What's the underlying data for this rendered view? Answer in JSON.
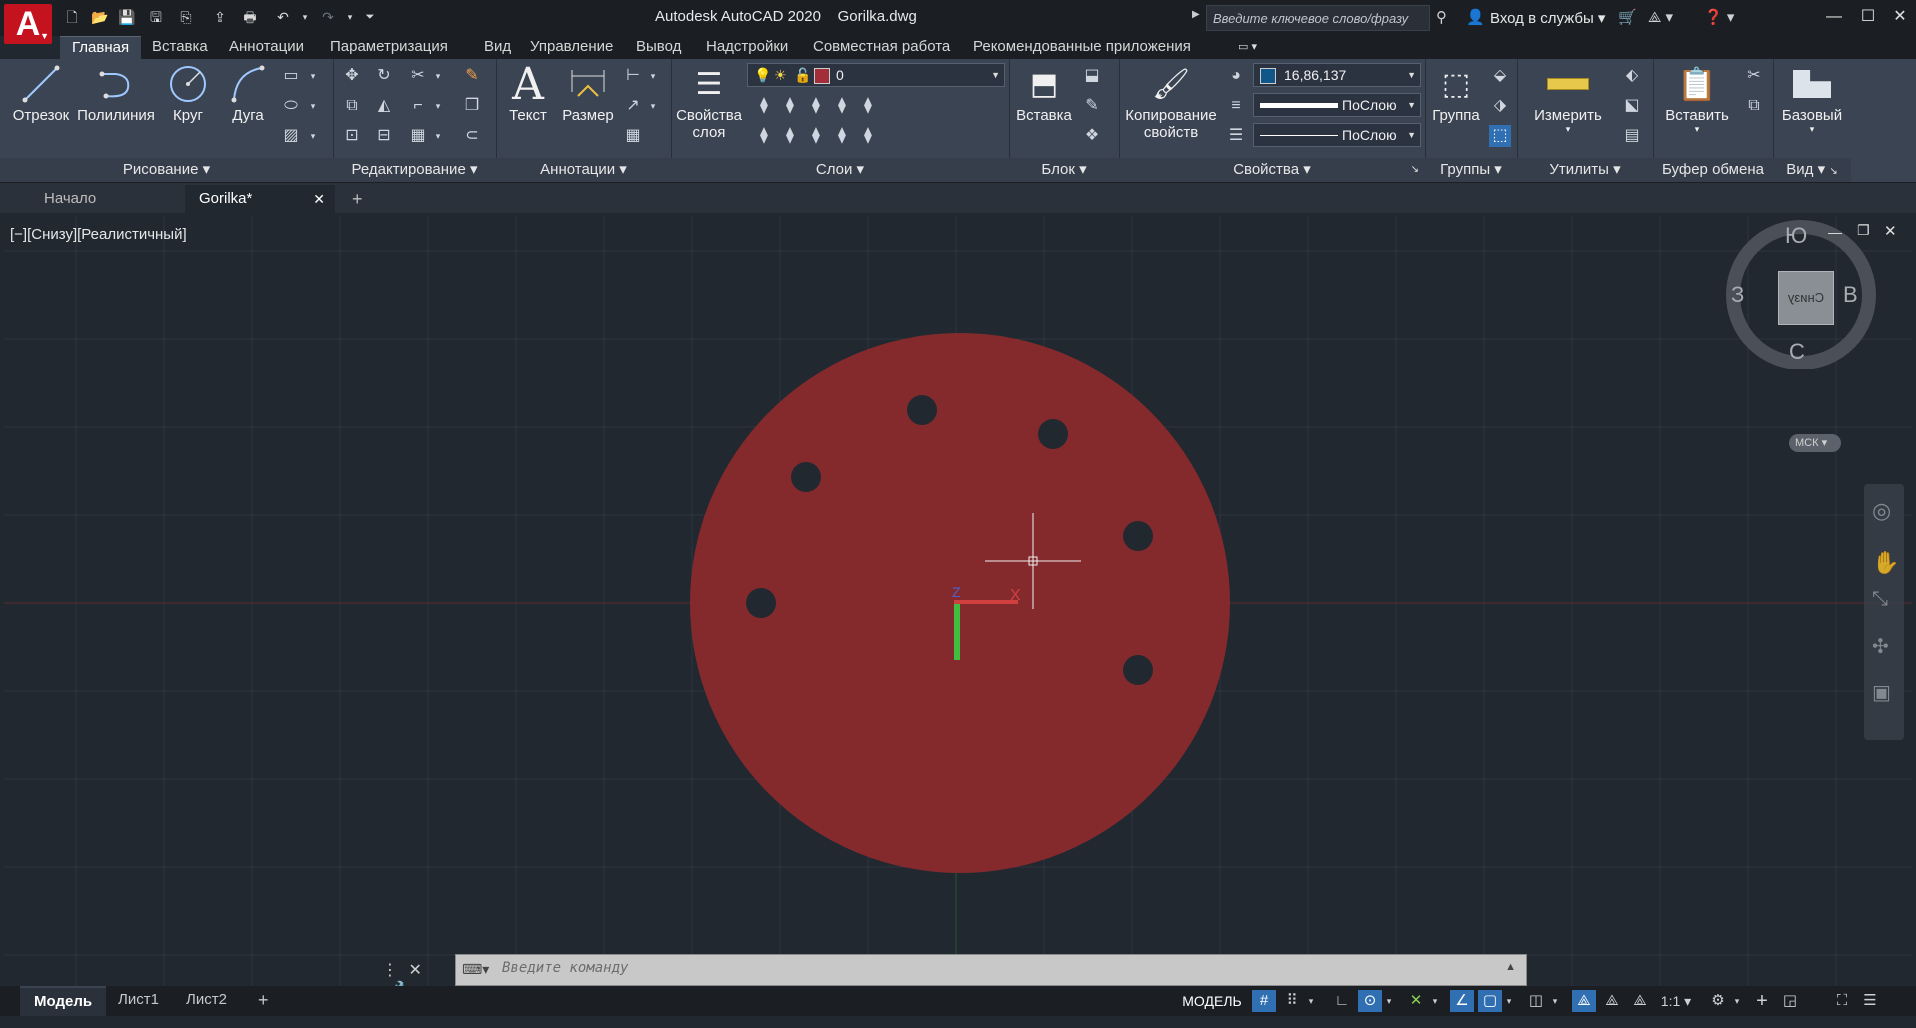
{
  "app": {
    "logo_letter": "A",
    "title": "Autodesk AutoCAD 2020",
    "document": "Gorilka.dwg",
    "search_placeholder": "Введите ключевое слово/фразу",
    "signin_label": "Вход в службы"
  },
  "ribbon_tabs": [
    {
      "label": "Главная",
      "active": true
    },
    {
      "label": "Вставка"
    },
    {
      "label": "Аннотации"
    },
    {
      "label": "Параметризация"
    },
    {
      "label": "Вид"
    },
    {
      "label": "Управление"
    },
    {
      "label": "Вывод"
    },
    {
      "label": "Надстройки"
    },
    {
      "label": "Совместная работа"
    },
    {
      "label": "Рекомендованные приложения"
    }
  ],
  "panels": {
    "draw": {
      "title": "Рисование",
      "tools": [
        "Отрезок",
        "Полилиния",
        "Круг",
        "Дуга"
      ]
    },
    "modify": {
      "title": "Редактирование"
    },
    "annotation": {
      "title": "Аннотации",
      "tools": [
        "Текст",
        "Размер"
      ]
    },
    "layers": {
      "title": "Слои",
      "props_label": "Свойства слоя",
      "current_layer": "0"
    },
    "block": {
      "title": "Блок",
      "insert_label": "Вставка"
    },
    "properties": {
      "title": "Свойства",
      "match_label": "Копирование свойств",
      "color_value": "16,86,137",
      "linetype_value": "ПоСлою",
      "lineweight_value": "ПоСлою"
    },
    "groups": {
      "title": "Группы",
      "group_label": "Группа"
    },
    "utilities": {
      "title": "Утилиты",
      "measure_label": "Измерить"
    },
    "clipboard": {
      "title": "Буфер обмена",
      "paste_label": "Вставить"
    },
    "view": {
      "title": "Вид",
      "base_label": "Базовый"
    }
  },
  "doc_tabs": [
    {
      "label": "Начало"
    },
    {
      "label": "Gorilka*",
      "active": true
    }
  ],
  "viewport": {
    "label": "[−][Снизу][Реалистичный]",
    "viewcube": {
      "north": "С",
      "south": "Ю",
      "west": "З",
      "east": "В",
      "face": "Снизу",
      "ucs": "МСК"
    },
    "axis_labels": {
      "x": "X",
      "z": "Z"
    }
  },
  "colors": {
    "disc_fill": "#842a2c",
    "background": "#212830",
    "accent": "#2f6fb2",
    "logo": "#c4121f"
  },
  "command_line": {
    "placeholder": "Введите команду"
  },
  "layout_tabs": [
    {
      "label": "Модель",
      "active": true
    },
    {
      "label": "Лист1"
    },
    {
      "label": "Лист2"
    }
  ],
  "status": {
    "model_label": "МОДЕЛЬ",
    "scale": "1:1"
  }
}
